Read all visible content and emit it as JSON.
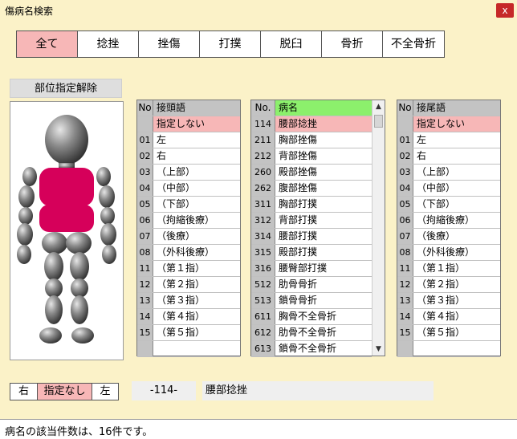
{
  "window": {
    "title": "傷病名検索",
    "close": "x"
  },
  "tabs": [
    "全て",
    "捻挫",
    "挫傷",
    "打撲",
    "脱臼",
    "骨折",
    "不全骨折"
  ],
  "body_panel": {
    "clear_label": "部位指定解除"
  },
  "prefix": {
    "header_no": "No",
    "header_label": "接頭語",
    "none_label": "指定しない",
    "items": [
      {
        "no": "01",
        "label": "左"
      },
      {
        "no": "02",
        "label": "右"
      },
      {
        "no": "03",
        "label": "（上部）"
      },
      {
        "no": "04",
        "label": "（中部）"
      },
      {
        "no": "05",
        "label": "（下部）"
      },
      {
        "no": "06",
        "label": "（拘縮後療）"
      },
      {
        "no": "07",
        "label": "（後療）"
      },
      {
        "no": "08",
        "label": "（外科後療）"
      },
      {
        "no": "11",
        "label": "（第１指）"
      },
      {
        "no": "12",
        "label": "（第２指）"
      },
      {
        "no": "13",
        "label": "（第３指）"
      },
      {
        "no": "14",
        "label": "（第４指）"
      },
      {
        "no": "15",
        "label": "（第５指）"
      }
    ]
  },
  "disease": {
    "header_no": "No.",
    "header_label": "病名",
    "items": [
      {
        "no": "114",
        "label": "腰部捻挫"
      },
      {
        "no": "211",
        "label": "胸部挫傷"
      },
      {
        "no": "212",
        "label": "背部挫傷"
      },
      {
        "no": "260",
        "label": "殿部挫傷"
      },
      {
        "no": "262",
        "label": "腹部挫傷"
      },
      {
        "no": "311",
        "label": "胸部打撲"
      },
      {
        "no": "312",
        "label": "背部打撲"
      },
      {
        "no": "314",
        "label": "腰部打撲"
      },
      {
        "no": "315",
        "label": "殿部打撲"
      },
      {
        "no": "316",
        "label": "腰臀部打撲"
      },
      {
        "no": "512",
        "label": "肋骨骨折"
      },
      {
        "no": "513",
        "label": "鎖骨骨折"
      },
      {
        "no": "611",
        "label": "胸骨不全骨折"
      },
      {
        "no": "612",
        "label": "肋骨不全骨折"
      },
      {
        "no": "613",
        "label": "鎖骨不全骨折"
      }
    ]
  },
  "suffix": {
    "header_no": "No",
    "header_label": "接尾語",
    "none_label": "指定しない",
    "items": [
      {
        "no": "01",
        "label": "左"
      },
      {
        "no": "02",
        "label": "右"
      },
      {
        "no": "03",
        "label": "（上部）"
      },
      {
        "no": "04",
        "label": "（中部）"
      },
      {
        "no": "05",
        "label": "（下部）"
      },
      {
        "no": "06",
        "label": "（拘縮後療）"
      },
      {
        "no": "07",
        "label": "（後療）"
      },
      {
        "no": "08",
        "label": "（外科後療）"
      },
      {
        "no": "11",
        "label": "（第１指）"
      },
      {
        "no": "12",
        "label": "（第２指）"
      },
      {
        "no": "13",
        "label": "（第３指）"
      },
      {
        "no": "14",
        "label": "（第４指）"
      },
      {
        "no": "15",
        "label": "（第５指）"
      }
    ]
  },
  "side_select": {
    "right": "右",
    "none": "指定なし",
    "left": "左"
  },
  "selection": {
    "code": "-114-",
    "name": "腰部捻挫"
  },
  "status": "病名の該当件数は、16件です。",
  "colors": {
    "background": "#fbf2c8",
    "selected": "#f7b7b7",
    "header_green": "#8cf06c",
    "body_highlight": "#d6005a"
  }
}
